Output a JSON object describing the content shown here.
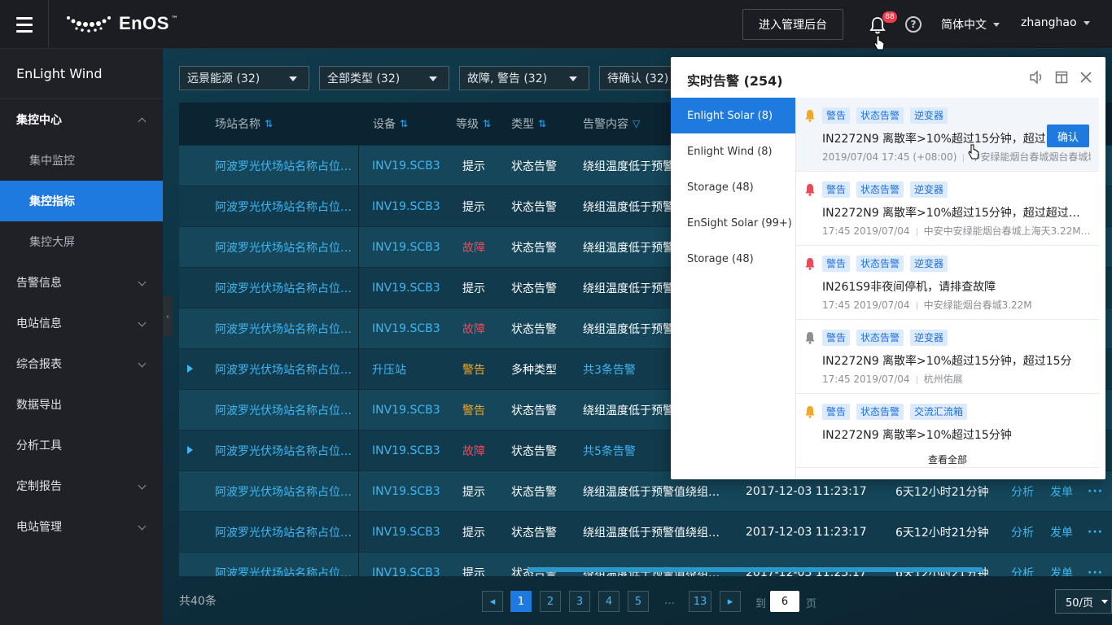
{
  "topbar": {
    "logo_text": "EnOS",
    "logo_mark": "™",
    "admin_button": "进入管理后台",
    "notif_count": "88",
    "help_label": "?",
    "language": "简体中文",
    "username": "zhanghao"
  },
  "sidebar": {
    "app_title": "EnLight Wind",
    "items": [
      {
        "label": "集控中心",
        "kind": "group"
      },
      {
        "label": "集中监控",
        "kind": "sub"
      },
      {
        "label": "集控指标",
        "kind": "sub-active"
      },
      {
        "label": "集控大屏",
        "kind": "sub"
      },
      {
        "label": "告警信息",
        "kind": "item"
      },
      {
        "label": "电站信息",
        "kind": "item"
      },
      {
        "label": "综合报表",
        "kind": "item"
      },
      {
        "label": "数据导出",
        "kind": "item"
      },
      {
        "label": "分析工具",
        "kind": "item"
      },
      {
        "label": "定制报告",
        "kind": "item"
      },
      {
        "label": "电站管理",
        "kind": "item"
      }
    ]
  },
  "filters": {
    "company": "远景能源 (32)",
    "type": "全部类型 (32)",
    "level": "故障, 警告 (32)",
    "status": "待确认 (32)"
  },
  "table": {
    "headers": {
      "station": "场站名称",
      "device": "设备",
      "level": "等级",
      "type": "类型",
      "content": "告警内容"
    },
    "rows": [
      {
        "name": "阿波罗光伏场站名称占位…",
        "device": "INV19.SCB3",
        "level": "提示",
        "level_color": "#ffffff",
        "type": "状态告警",
        "content": "绕组温度低于预警",
        "time": "",
        "duration": "",
        "expandable": false
      },
      {
        "name": "阿波罗光伏场站名称占位…",
        "device": "INV19.SCB3",
        "level": "提示",
        "level_color": "#ffffff",
        "type": "状态告警",
        "content": "绕组温度低于预警",
        "time": "",
        "duration": "",
        "expandable": false
      },
      {
        "name": "阿波罗光伏场站名称占位…",
        "device": "INV19.SCB3",
        "level": "故障",
        "level_color": "#f0485a",
        "type": "状态告警",
        "content": "绕组温度低于预警",
        "time": "",
        "duration": "",
        "expandable": false
      },
      {
        "name": "阿波罗光伏场站名称占位…",
        "device": "INV19.SCB3",
        "level": "提示",
        "level_color": "#ffffff",
        "type": "状态告警",
        "content": "绕组温度低于预警",
        "time": "",
        "duration": "",
        "expandable": false
      },
      {
        "name": "阿波罗光伏场站名称占位…",
        "device": "INV19.SCB3",
        "level": "故障",
        "level_color": "#f0485a",
        "type": "状态告警",
        "content": "绕组温度低于预警",
        "time": "",
        "duration": "",
        "expandable": false
      },
      {
        "name": "阿波罗光伏场站名称占位…",
        "device": "升压站",
        "level": "警告",
        "level_color": "#f5a623",
        "type": "多种类型",
        "content": "共3条告警",
        "content_link": true,
        "time": "",
        "duration": "",
        "expandable": true
      },
      {
        "name": "阿波罗光伏场站名称占位…",
        "device": "INV19.SCB3",
        "level": "警告",
        "level_color": "#f5a623",
        "type": "状态告警",
        "content": "绕组温度低于预警",
        "time": "",
        "duration": "",
        "expandable": false
      },
      {
        "name": "阿波罗光伏场站名称占位…",
        "device": "INV19.SCB3",
        "level": "故障",
        "level_color": "#f0485a",
        "type": "状态告警",
        "content": "共5条告警",
        "content_link": true,
        "time": "",
        "duration": "",
        "expandable": true
      },
      {
        "name": "阿波罗光伏场站名称占位…",
        "device": "INV19.SCB3",
        "level": "提示",
        "level_color": "#ffffff",
        "type": "状态告警",
        "content": "绕组温度低于预警值绕组…",
        "time": "2017-12-03 11:23:17",
        "duration": "6天12小时21分钟",
        "expandable": false
      },
      {
        "name": "阿波罗光伏场站名称占位…",
        "device": "INV19.SCB3",
        "level": "提示",
        "level_color": "#ffffff",
        "type": "状态告警",
        "content": "绕组温度低于预警值绕组…",
        "time": "2017-12-03 11:23:17",
        "duration": "6天12小时21分钟",
        "expandable": false
      },
      {
        "name": "阿波罗光伏场站名称占位…",
        "device": "INV19.SCB3",
        "level": "提示",
        "level_color": "#ffffff",
        "type": "状态告警",
        "content": "绕组温度低于预警值绕组…",
        "time": "2017-12-03 11:23:17",
        "duration": "6天12小时21分钟",
        "expandable": false
      }
    ],
    "row_actions": {
      "analyze": "分析",
      "dispatch": "发单",
      "more": "···"
    }
  },
  "footer": {
    "total": "共40条",
    "pages": [
      "1",
      "2",
      "3",
      "4",
      "5",
      "…",
      "13"
    ],
    "current_page": "1",
    "goto_label": "到",
    "goto_value": "6",
    "page_unit": "页",
    "page_size": "50/页"
  },
  "popup": {
    "title": "实时告警 (254)",
    "sources": [
      {
        "label": "Enlight Solar (8)",
        "active": true
      },
      {
        "label": "Enlight Wind (8)",
        "active": false
      },
      {
        "label": "Storage (48)",
        "active": false
      },
      {
        "label": "EnSight Solar (99+)",
        "active": false
      },
      {
        "label": "Storage (48)",
        "active": false
      }
    ],
    "alerts": [
      {
        "bell_color": "#f5a623",
        "tags": [
          "警告",
          "状态告警",
          "逆变器"
        ],
        "message": "IN2272N9 离散率>10%超过15分钟，超过15",
        "time": "2019/07/04 17:45 (+08:00)",
        "location": "中安绿能烟台春城烟台春城城",
        "highlight": true
      },
      {
        "bell_color": "#f0485a",
        "tags": [
          "警告",
          "状态告警",
          "逆变器"
        ],
        "message": "IN2272N9 离散率>10%超过15分钟，超过超过超过1…",
        "time": "17:45 2019/07/04",
        "location": "中安中安绿能烟台春城上海天3.22M…",
        "highlight": false
      },
      {
        "bell_color": "#f0485a",
        "tags": [
          "警告",
          "状态告警",
          "逆变器"
        ],
        "message": "IN261S9非夜间停机，请排查故障",
        "time": "17:45 2019/07/04",
        "location": "中安绿能烟台春城3.22M",
        "highlight": false
      },
      {
        "bell_color": "#8a8f96",
        "tags": [
          "警告",
          "状态告警",
          "逆变器"
        ],
        "message": "IN2272N9 离散率>10%超过15分钟，超过15分",
        "time": "17:45 2019/07/04",
        "location": "杭州佑展",
        "highlight": false
      },
      {
        "bell_color": "#f5a623",
        "tags": [
          "警告",
          "状态告警",
          "交流汇流箱"
        ],
        "message": "IN2272N9 离散率>10%超过15分钟",
        "time": "",
        "location": "",
        "highlight": false
      }
    ],
    "confirm_label": "确认",
    "view_all": "查看全部"
  }
}
